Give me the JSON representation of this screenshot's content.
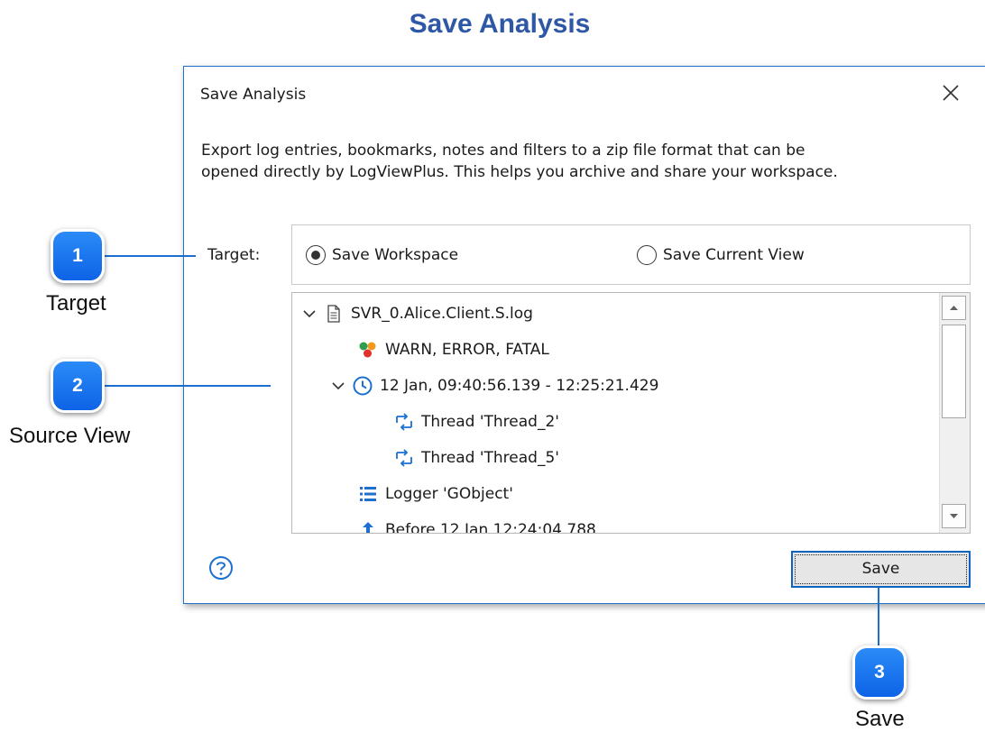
{
  "page_title": "Save Analysis",
  "dialog": {
    "title": "Save Analysis",
    "description_line1": "Export log entries, bookmarks, notes and filters to a zip file format that can be",
    "description_line2": "opened directly by LogViewPlus.  This helps you archive and share your workspace.",
    "target_label": "Target:",
    "radios": [
      {
        "label": "Save Workspace",
        "checked": true
      },
      {
        "label": "Save Current View",
        "checked": false
      }
    ],
    "tree": [
      {
        "label": "SVR_0.Alice.Client.S.log",
        "icon": "document-icon",
        "expanded": true
      },
      {
        "label": "WARN, ERROR, FATAL",
        "icon": "level-filter-icon"
      },
      {
        "label": "12 Jan, 09:40:56.139 - 12:25:21.429",
        "icon": "clock-icon",
        "expanded": true
      },
      {
        "label": "Thread 'Thread_2'",
        "icon": "thread-icon"
      },
      {
        "label": "Thread 'Thread_5'",
        "icon": "thread-icon"
      },
      {
        "label": "Logger 'GObject'",
        "icon": "logger-icon"
      },
      {
        "label": "Before 12 Jan 12:24:04.788",
        "icon": "before-icon"
      }
    ],
    "save_button": "Save"
  },
  "callouts": [
    {
      "number": "1",
      "label": "Target"
    },
    {
      "number": "2",
      "label": "Source View"
    },
    {
      "number": "3",
      "label": "Save"
    }
  ],
  "colors": {
    "accent": "#1c6fd1",
    "title": "#2e58a6",
    "dialog_border": "#1e75c8"
  }
}
